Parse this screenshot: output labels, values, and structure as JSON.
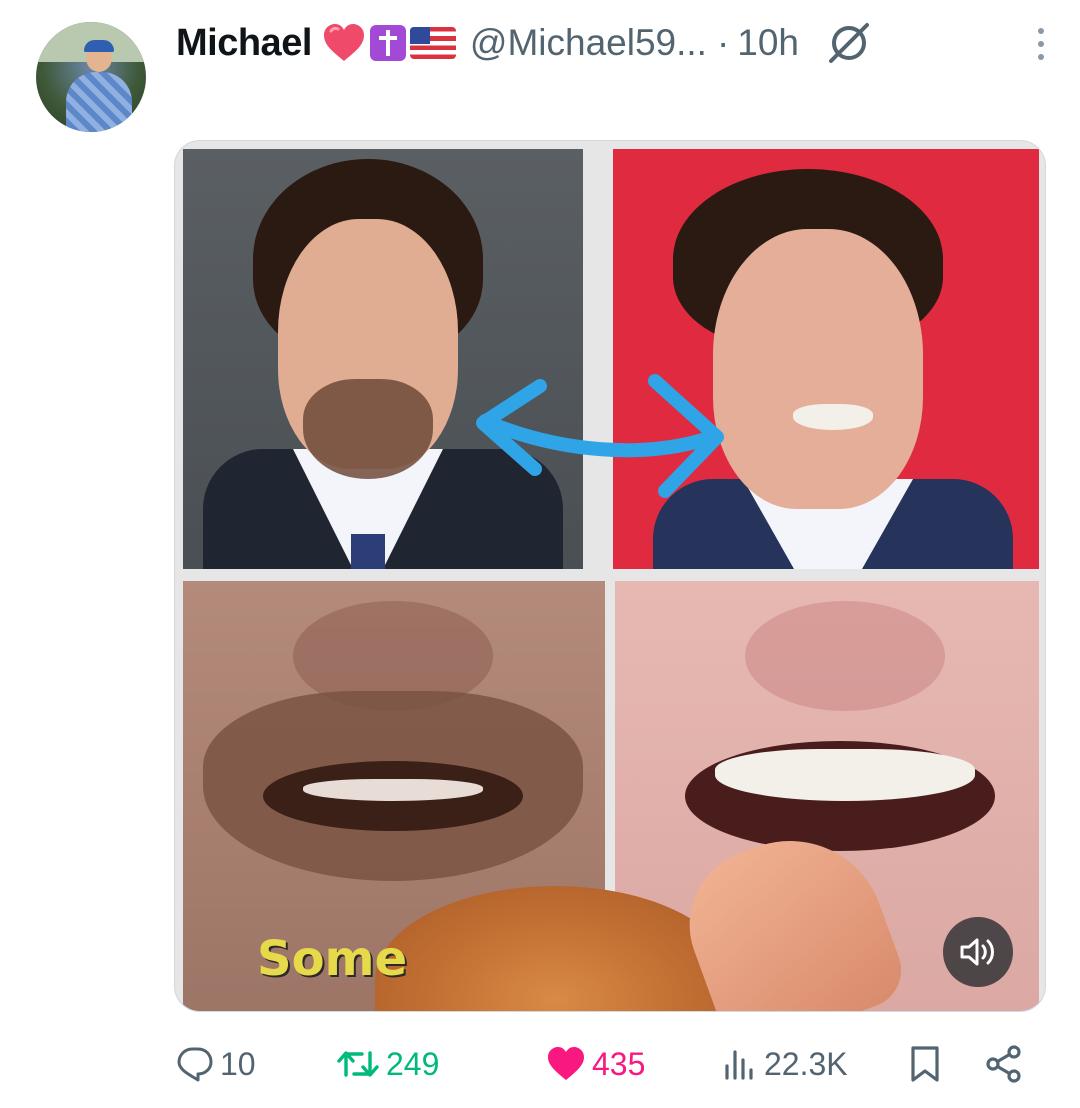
{
  "post": {
    "author_name": "Michael",
    "author_handle": "@Michael59...",
    "separator": "·",
    "time": "10h",
    "name_emojis": [
      "red-heart",
      "latin-cross",
      "us-flag"
    ]
  },
  "media": {
    "caption_overlay": "Some",
    "sound_state": "unmuted"
  },
  "actions": {
    "replies": "10",
    "reposts": "249",
    "likes": "435",
    "views": "22.3K"
  },
  "colors": {
    "repost_active": "#00ba7c",
    "like_active": "#f91880",
    "secondary_text": "#536471"
  }
}
